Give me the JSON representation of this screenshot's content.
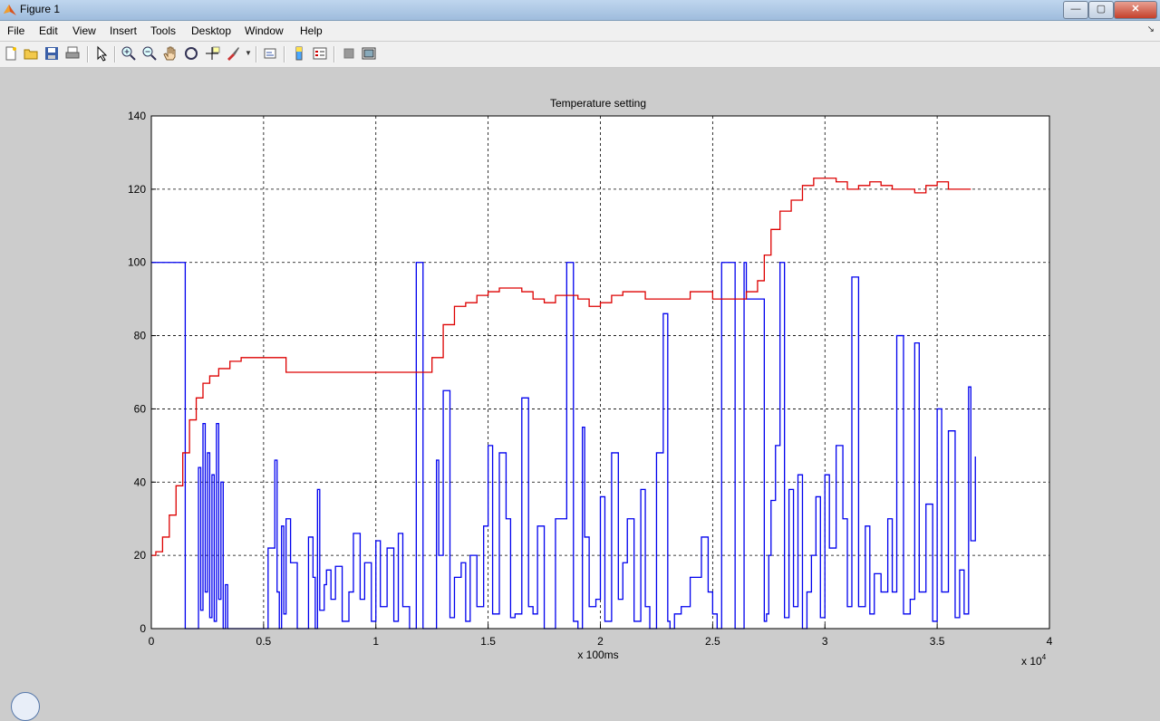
{
  "window": {
    "title": "Figure 1",
    "minimize": "—",
    "maximize": "▢",
    "close": "✕"
  },
  "menu": [
    "File",
    "Edit",
    "View",
    "Insert",
    "Tools",
    "Desktop",
    "Window",
    "Help"
  ],
  "menu_arrow": "↘",
  "toolbar": [
    "new-figure-icon",
    "open-file-icon",
    "save-icon",
    "print-icon",
    "select-arrow-icon",
    "zoom-in-icon",
    "zoom-out-icon",
    "pan-hand-icon",
    "rotate-3d-icon",
    "data-cursor-icon",
    "brush-icon",
    "link-plot-icon",
    "colorbar-icon",
    "legend-icon",
    "hide-plot-tools-icon",
    "show-plot-tools-icon"
  ],
  "colors": {
    "setpoint": "#dd0000",
    "output": "#0000ee",
    "grid": "#000000",
    "background": "#cccccc"
  },
  "chart_data": {
    "type": "line",
    "title": "Temperature setting",
    "xlabel": "x 100ms",
    "ylabel": "",
    "x_multiplier": "x 10",
    "x_multiplier_exp": "4",
    "xlim": [
      0,
      4
    ],
    "ylim": [
      0,
      140
    ],
    "xticks": [
      "0",
      "0.5",
      "1",
      "1.5",
      "2",
      "2.5",
      "3",
      "3.5",
      "4"
    ],
    "yticks": [
      "0",
      "20",
      "40",
      "60",
      "80",
      "100",
      "120",
      "140"
    ],
    "grid": true,
    "series": [
      {
        "color": "#dd0000",
        "x": [
          0,
          0.02,
          0.05,
          0.08,
          0.11,
          0.14,
          0.17,
          0.2,
          0.23,
          0.26,
          0.3,
          0.35,
          0.4,
          0.5,
          0.6,
          0.7,
          0.8,
          0.9,
          1.0,
          1.1,
          1.2,
          1.25,
          1.3,
          1.35,
          1.4,
          1.45,
          1.5,
          1.55,
          1.6,
          1.65,
          1.7,
          1.75,
          1.8,
          1.85,
          1.9,
          1.95,
          2.0,
          2.05,
          2.1,
          2.2,
          2.3,
          2.4,
          2.5,
          2.6,
          2.65,
          2.7,
          2.73,
          2.76,
          2.8,
          2.85,
          2.9,
          2.95,
          3.0,
          3.05,
          3.1,
          3.15,
          3.2,
          3.25,
          3.3,
          3.35,
          3.4,
          3.45,
          3.5,
          3.55,
          3.6,
          3.65
        ],
        "values": [
          20,
          21,
          25,
          31,
          39,
          48,
          57,
          63,
          67,
          69,
          71,
          73,
          74,
          74,
          70,
          70,
          70,
          70,
          70,
          70,
          70,
          74,
          83,
          88,
          89,
          91,
          92,
          93,
          93,
          92,
          90,
          89,
          91,
          91,
          90,
          88,
          89,
          91,
          92,
          90,
          90,
          92,
          90,
          90,
          92,
          95,
          102,
          109,
          114,
          117,
          121,
          123,
          123,
          122,
          120,
          121,
          122,
          121,
          120,
          120,
          119,
          121,
          122,
          120,
          120,
          120
        ]
      },
      {
        "color": "#0000ee",
        "x": [
          0,
          0.15,
          0.151,
          0.2,
          0.21,
          0.22,
          0.23,
          0.24,
          0.25,
          0.26,
          0.27,
          0.28,
          0.29,
          0.3,
          0.31,
          0.32,
          0.33,
          0.34,
          0.36,
          0.4,
          0.5,
          0.52,
          0.55,
          0.56,
          0.57,
          0.58,
          0.59,
          0.6,
          0.62,
          0.65,
          0.7,
          0.72,
          0.73,
          0.74,
          0.75,
          0.77,
          0.78,
          0.8,
          0.82,
          0.85,
          0.88,
          0.9,
          0.93,
          0.95,
          0.98,
          1.0,
          1.02,
          1.05,
          1.08,
          1.1,
          1.12,
          1.15,
          1.18,
          1.2,
          1.21,
          1.26,
          1.27,
          1.28,
          1.3,
          1.33,
          1.35,
          1.38,
          1.4,
          1.42,
          1.45,
          1.48,
          1.5,
          1.52,
          1.55,
          1.58,
          1.6,
          1.62,
          1.65,
          1.68,
          1.7,
          1.72,
          1.75,
          1.8,
          1.85,
          1.88,
          1.9,
          1.92,
          1.93,
          1.95,
          1.98,
          2.0,
          2.02,
          2.05,
          2.08,
          2.1,
          2.12,
          2.15,
          2.18,
          2.2,
          2.22,
          2.25,
          2.28,
          2.3,
          2.31,
          2.33,
          2.36,
          2.4,
          2.45,
          2.48,
          2.5,
          2.52,
          2.54,
          2.56,
          2.6,
          2.64,
          2.65,
          2.73,
          2.74,
          2.75,
          2.76,
          2.78,
          2.8,
          2.82,
          2.84,
          2.86,
          2.88,
          2.9,
          2.92,
          2.94,
          2.96,
          2.98,
          3.0,
          3.02,
          3.05,
          3.08,
          3.1,
          3.12,
          3.15,
          3.18,
          3.2,
          3.22,
          3.25,
          3.28,
          3.3,
          3.32,
          3.35,
          3.38,
          3.4,
          3.42,
          3.45,
          3.48,
          3.5,
          3.52,
          3.55,
          3.58,
          3.6,
          3.62,
          3.64,
          3.65,
          3.67
        ],
        "values": [
          100,
          100,
          0,
          0,
          44,
          5,
          56,
          10,
          48,
          3,
          42,
          2,
          56,
          8,
          40,
          0,
          12,
          0,
          0,
          0,
          0,
          22,
          46,
          10,
          0,
          28,
          4,
          30,
          18,
          0,
          25,
          14,
          0,
          38,
          5,
          12,
          16,
          8,
          17,
          2,
          10,
          26,
          8,
          18,
          2,
          24,
          6,
          22,
          2,
          26,
          6,
          0,
          100,
          100,
          0,
          0,
          46,
          20,
          65,
          3,
          14,
          18,
          2,
          20,
          6,
          28,
          50,
          4,
          48,
          30,
          3,
          4,
          63,
          6,
          4,
          28,
          0,
          30,
          100,
          2,
          0,
          55,
          25,
          6,
          8,
          36,
          2,
          48,
          8,
          18,
          30,
          2,
          38,
          6,
          0,
          48,
          86,
          2,
          0,
          4,
          6,
          14,
          25,
          10,
          4,
          0,
          100,
          100,
          0,
          100,
          90,
          2,
          4,
          20,
          35,
          50,
          100,
          3,
          38,
          6,
          42,
          0,
          10,
          20,
          36,
          3,
          42,
          22,
          50,
          30,
          6,
          96,
          6,
          28,
          4,
          15,
          10,
          30,
          10,
          80,
          4,
          8,
          78,
          10,
          34,
          2,
          60,
          10,
          54,
          3,
          16,
          4,
          66,
          24,
          47
        ]
      }
    ]
  }
}
